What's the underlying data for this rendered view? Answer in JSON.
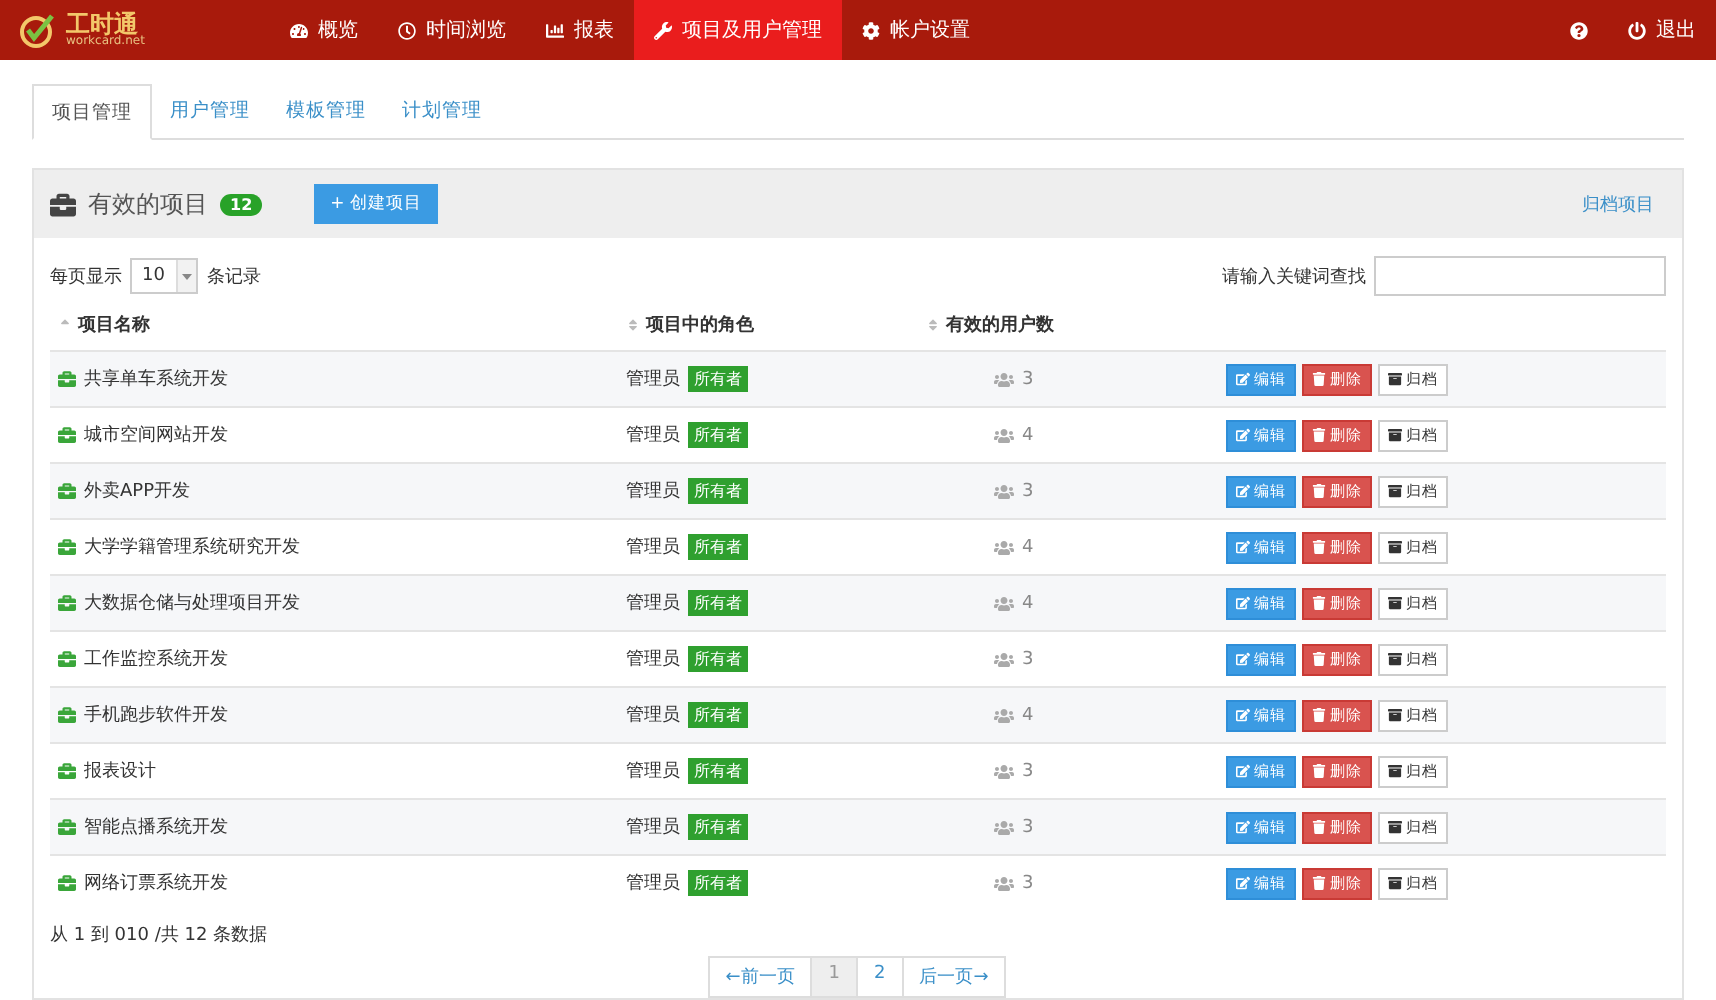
{
  "logo": {
    "name": "工时通",
    "domain": "workcard.net"
  },
  "nav": [
    {
      "label": "概览",
      "selected": false
    },
    {
      "label": "时间浏览",
      "selected": false
    },
    {
      "label": "报表",
      "selected": false
    },
    {
      "label": "项目及用户管理",
      "selected": true
    },
    {
      "label": "帐户设置",
      "selected": false
    }
  ],
  "logout": "退出",
  "tabs": [
    {
      "label": "项目管理",
      "selected": true
    },
    {
      "label": "用户管理",
      "selected": false
    },
    {
      "label": "模板管理",
      "selected": false
    },
    {
      "label": "计划管理",
      "selected": false
    }
  ],
  "panel": {
    "title": "有效的项目",
    "count": "12",
    "create_button": "+ 创建项目",
    "archive_link": "归档项目"
  },
  "page_size": {
    "prefix": "每页显示",
    "value": "10",
    "suffix": "条记录"
  },
  "search": {
    "label": "请输入关键词查找"
  },
  "table": {
    "columns": [
      "项目名称",
      "项目中的角色",
      "有效的用户数"
    ],
    "rows": [
      {
        "name": "共享单车系统开发",
        "role": "管理员",
        "tag": "所有者",
        "users": "3",
        "actions": [
          "编辑",
          "删除",
          "归档"
        ]
      },
      {
        "name": "城市空间网站开发",
        "role": "管理员",
        "tag": "所有者",
        "users": "4",
        "actions": [
          "编辑",
          "删除",
          "归档"
        ]
      },
      {
        "name": "外卖APP开发",
        "role": "管理员",
        "tag": "所有者",
        "users": "3",
        "actions": [
          "编辑",
          "删除",
          "归档"
        ]
      },
      {
        "name": "大学学籍管理系统研究开发",
        "role": "管理员",
        "tag": "所有者",
        "users": "4",
        "actions": [
          "编辑",
          "删除",
          "归档"
        ]
      },
      {
        "name": "大数据仓储与处理项目开发",
        "role": "管理员",
        "tag": "所有者",
        "users": "4",
        "actions": [
          "编辑",
          "删除",
          "归档"
        ]
      },
      {
        "name": "工作监控系统开发",
        "role": "管理员",
        "tag": "所有者",
        "users": "3",
        "actions": [
          "编辑",
          "删除",
          "归档"
        ]
      },
      {
        "name": "手机跑步软件开发",
        "role": "管理员",
        "tag": "所有者",
        "users": "4",
        "actions": [
          "编辑",
          "删除",
          "归档"
        ]
      },
      {
        "name": "报表设计",
        "role": "管理员",
        "tag": "所有者",
        "users": "3",
        "actions": [
          "编辑",
          "删除",
          "归档"
        ]
      },
      {
        "name": "智能点播系统开发",
        "role": "管理员",
        "tag": "所有者",
        "users": "3",
        "actions": [
          "编辑",
          "删除",
          "归档"
        ]
      },
      {
        "name": "网络订票系统开发",
        "role": "管理员",
        "tag": "所有者",
        "users": "3",
        "actions": [
          "编辑",
          "删除",
          "归档"
        ]
      }
    ]
  },
  "summary": "从 1 到 010 /共 12 条数据",
  "pagination": [
    {
      "label": "←前一页",
      "selected": false
    },
    {
      "label": "1",
      "selected": true
    },
    {
      "label": "2",
      "selected": false
    },
    {
      "label": "后一页→",
      "selected": false
    }
  ]
}
